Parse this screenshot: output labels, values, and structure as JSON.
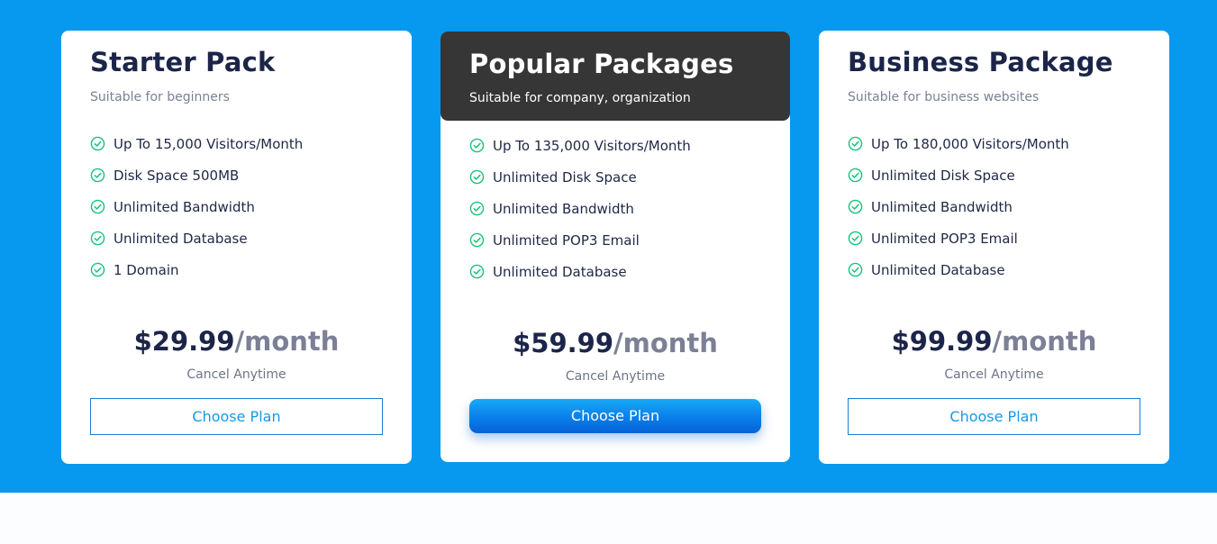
{
  "plans": [
    {
      "title": "Starter Pack",
      "subtitle": "Suitable for beginners",
      "features": [
        "Up To 15,000 Visitors/Month",
        "Disk Space 500MB",
        "Unlimited Bandwidth",
        "Unlimited Database",
        "1 Domain"
      ],
      "price": "$29.99",
      "period": "/month",
      "note": "Cancel Anytime",
      "button_label": "Choose Plan"
    },
    {
      "title": "Popular Packages",
      "subtitle": "Suitable for company, organization",
      "features": [
        "Up To 135,000 Visitors/Month",
        "Unlimited Disk Space",
        "Unlimited Bandwidth",
        "Unlimited POP3 Email",
        "Unlimited Database"
      ],
      "price": "$59.99",
      "period": "/month",
      "note": "Cancel Anytime",
      "button_label": "Choose Plan"
    },
    {
      "title": "Business Package",
      "subtitle": "Suitable for business websites",
      "features": [
        "Up To 180,000 Visitors/Month",
        "Unlimited Disk Space",
        "Unlimited Bandwidth",
        "Unlimited POP3 Email",
        "Unlimited Database"
      ],
      "price": "$99.99",
      "period": "/month",
      "note": "Cancel Anytime",
      "button_label": "Choose Plan"
    }
  ],
  "icons": {
    "feature": "check-circle-icon"
  },
  "colors": {
    "background": "#0799ef",
    "check": "#1bc47d",
    "highlight_header": "#363636",
    "button_accent": "#1699e6"
  }
}
